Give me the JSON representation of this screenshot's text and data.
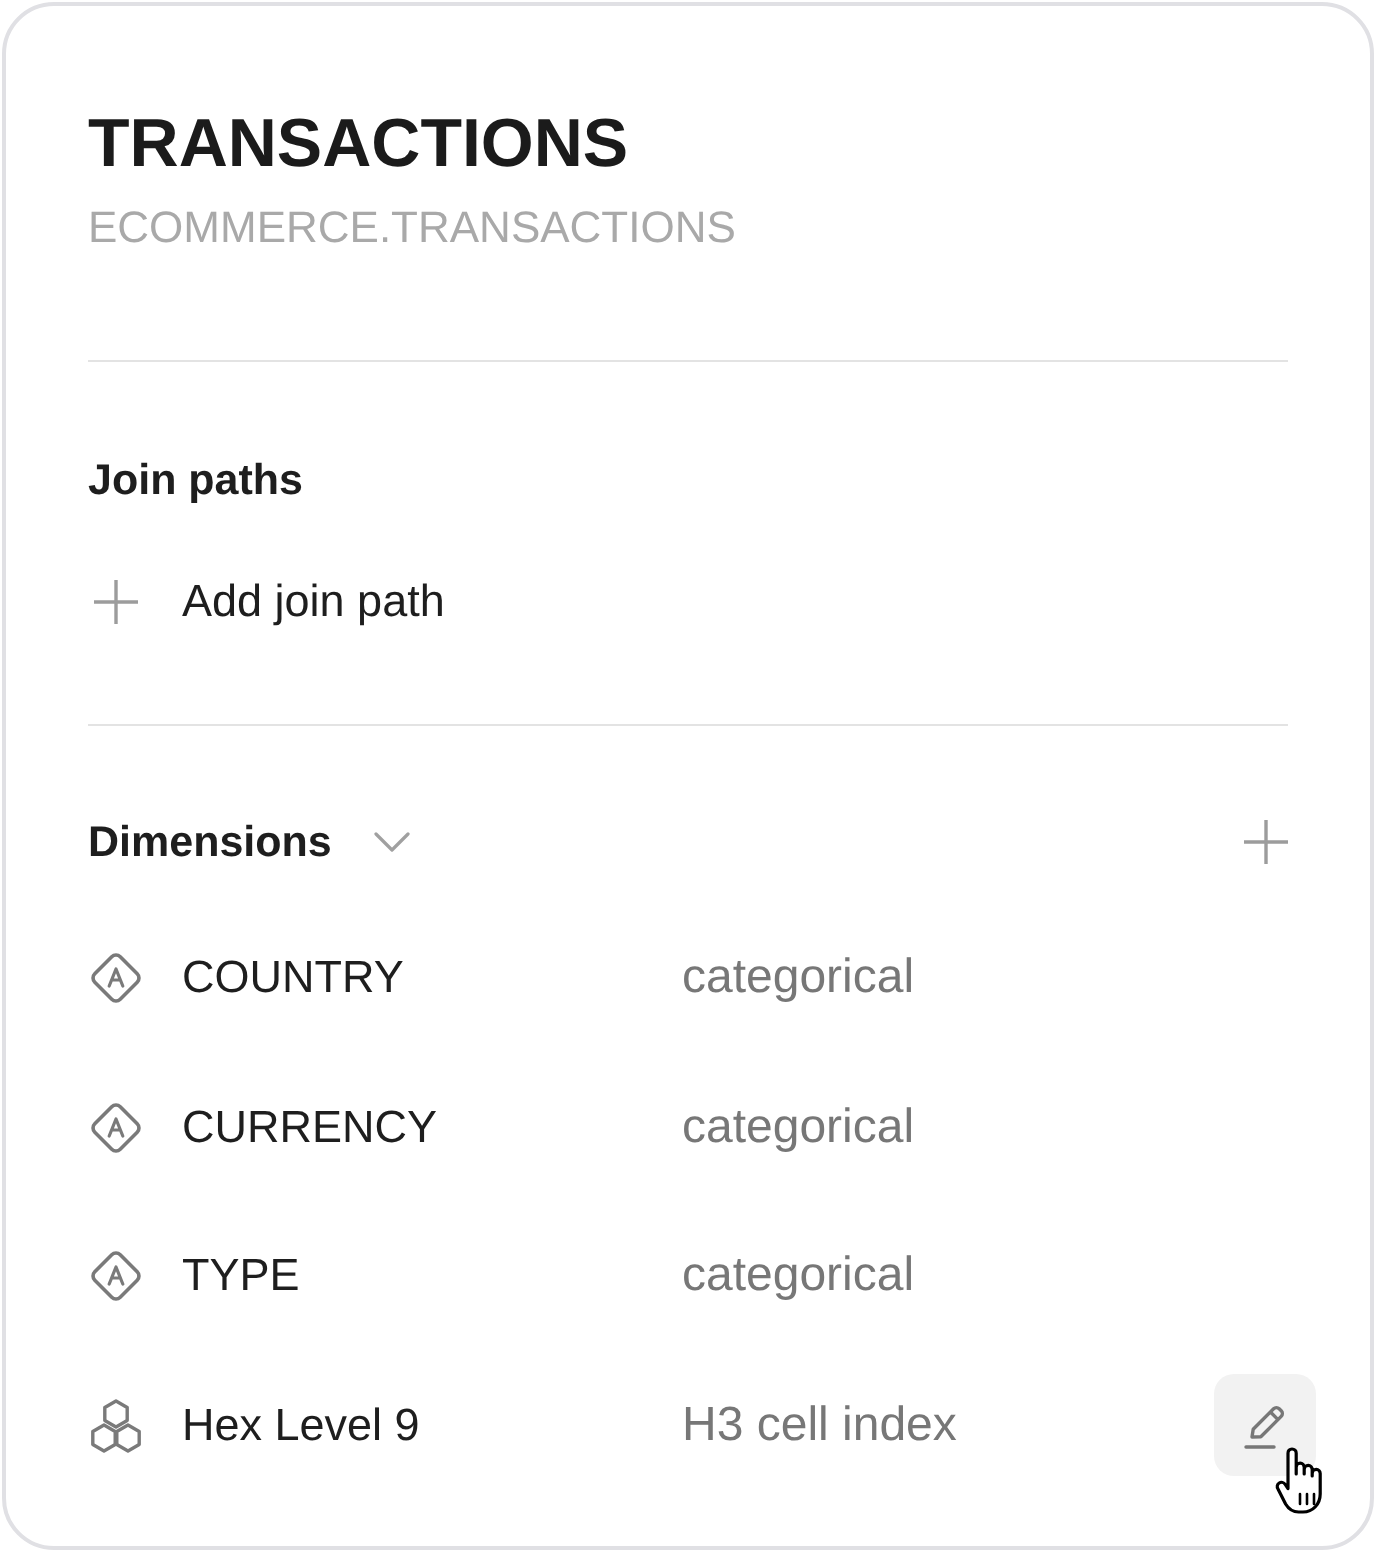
{
  "table": {
    "title": "TRANSACTIONS",
    "subtitle": "ECOMMERCE.TRANSACTIONS"
  },
  "join_paths": {
    "heading": "Join paths",
    "add_label": "Add join path"
  },
  "dimensions": {
    "heading": "Dimensions",
    "expanded": true,
    "items": [
      {
        "kind": "categorical",
        "name": "COUNTRY",
        "type": "categorical",
        "hovered": false
      },
      {
        "kind": "categorical",
        "name": "CURRENCY",
        "type": "categorical",
        "hovered": false
      },
      {
        "kind": "categorical",
        "name": "TYPE",
        "type": "categorical",
        "hovered": false
      },
      {
        "kind": "hex",
        "name": "Hex Level 9",
        "type": "H3 cell index",
        "hovered": true
      }
    ]
  }
}
